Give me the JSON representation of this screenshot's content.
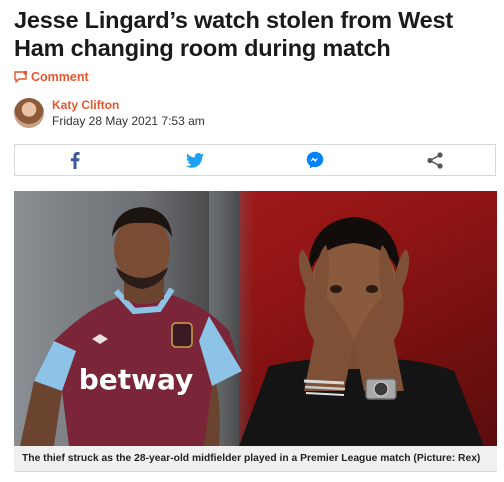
{
  "article": {
    "headline": "Jesse Lingard’s watch stolen from West Ham changing room during match",
    "comment_label": "Comment",
    "author": "Katy Clifton",
    "date": "Friday 28 May 2021 7:53 am"
  },
  "share": {
    "icons": [
      "facebook-icon",
      "twitter-icon",
      "messenger-icon",
      "share-icon"
    ],
    "colors": {
      "facebook": "#3b5998",
      "twitter": "#1da1f2",
      "messenger": "#0084ff",
      "share": "#555555"
    }
  },
  "image": {
    "shirt_text": "betway",
    "caption": "The thief struck as the 28-year-old midfielder played in a Premier League match (Picture: Rex)"
  },
  "theme": {
    "accent": "#e4572e"
  }
}
